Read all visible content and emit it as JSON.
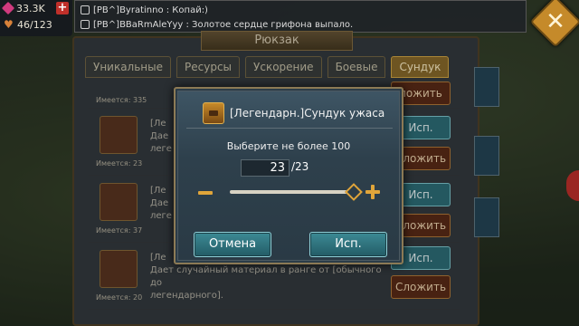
{
  "hud": {
    "gems": "33.3K",
    "stamina": "46/123"
  },
  "chat": {
    "lines": [
      "[PB^]Byratinno : Копай:)",
      "[PB^]BBaRmAleYyy : Золотое сердце грифона выпало."
    ]
  },
  "backpack": {
    "title": "Рюкзак",
    "tabs": [
      "Уникальные",
      "Ресурсы",
      "Ускорение",
      "Боевые",
      "Сундук"
    ],
    "active_tab": "Сундук",
    "rows": [
      {
        "name": "",
        "desc": "",
        "count": "Имеется: 335",
        "button": ""
      },
      {
        "name": "[Ле",
        "desc": "Дае",
        "desc2": "леге",
        "count": "Имеется: 23",
        "button": "Исп.",
        "button2": "Сложить"
      },
      {
        "name": "[Ле",
        "desc": "Дае",
        "desc2": "леге",
        "count": "Имеется: 37",
        "button": "Исп.",
        "button2": "Сложить"
      },
      {
        "name": "[Ле",
        "desc": "Дает случайный материал в ранге от [обычного до",
        "desc2": "легендарного].",
        "count": "Имеется: 20",
        "button": "Исп.",
        "button2": "Сложить"
      }
    ],
    "top_button": "ложить"
  },
  "dialog": {
    "title": "[Легендарн.]Сундук ужаса",
    "prompt": "Выберите не более 100",
    "quantity": "23",
    "max": "/23",
    "cancel": "Отмена",
    "use": "Исп."
  }
}
